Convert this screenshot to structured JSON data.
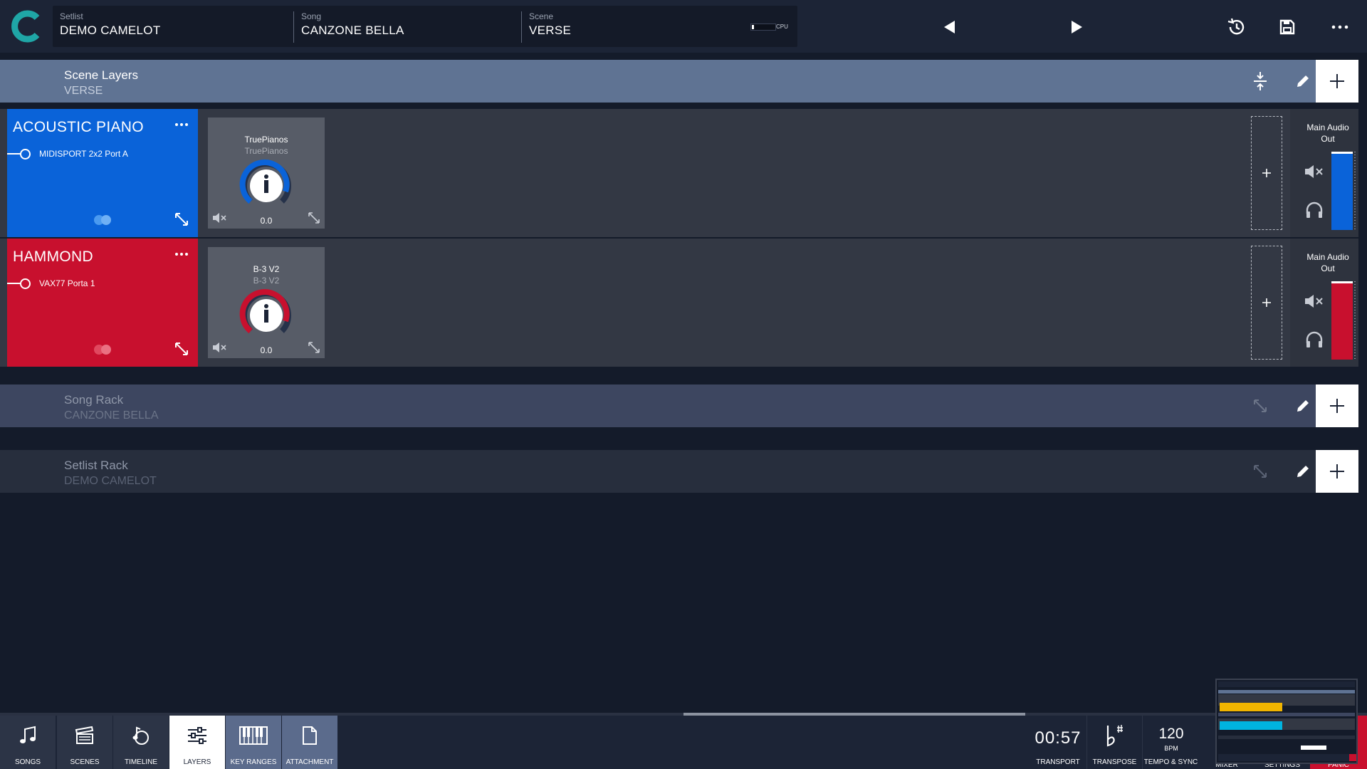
{
  "header": {
    "setlist_label": "Setlist",
    "setlist_value": "DEMO CAMELOT",
    "song_label": "Song",
    "song_value": "CANZONE BELLA",
    "scene_label": "Scene",
    "scene_value": "VERSE",
    "cpu_label": "CPU",
    "icons": [
      "previous-icon",
      "next-icon",
      "history-icon",
      "save-icon",
      "more-icon"
    ]
  },
  "scene_layers": {
    "title": "Scene Layers",
    "subtitle": "VERSE",
    "icons": [
      "collapse-icon",
      "edit-icon",
      "add-icon"
    ]
  },
  "layers": [
    {
      "name": "ACOUSTIC PIANO",
      "midi_input": "MIDISPORT 2x2 Port A",
      "color": "#0a63d9",
      "plugin_name": "TruePianos",
      "plugin_subtitle": "TruePianos",
      "plugin_value": "0.0",
      "output_label": "Main Audio Out"
    },
    {
      "name": "HAMMOND",
      "midi_input": "VAX77 Porta 1",
      "color": "#c8102e",
      "plugin_name": "B-3 V2",
      "plugin_subtitle": "B-3 V2",
      "plugin_value": "0.0",
      "output_label": "Main Audio Out"
    }
  ],
  "song_rack": {
    "title": "Song Rack",
    "subtitle": "CANZONE BELLA"
  },
  "setlist_rack": {
    "title": "Setlist Rack",
    "subtitle": "DEMO CAMELOT"
  },
  "bottom_nav": {
    "songs": "SONGS",
    "scenes": "SCENES",
    "timeline": "TIMELINE",
    "layers": "LAYERS",
    "key_ranges": "KEY RANGES",
    "attachment": "ATTACHMENT",
    "active": "LAYERS"
  },
  "transport": {
    "time": "00:57",
    "transport_label": "TRANSPORT",
    "transpose_label": "TRANSPOSE",
    "tempo_value": "120",
    "tempo_unit": "BPM",
    "tempo_label": "TEMPO & SYNC",
    "mixer_label": "MIXER",
    "settings_label": "SETTINGS",
    "panic_label": "PANIC"
  },
  "colors": {
    "accent_teal": "#1fa6a6",
    "piano_blue": "#0a63d9",
    "hammond_red": "#c8102e",
    "section_header": "#5f7393"
  }
}
